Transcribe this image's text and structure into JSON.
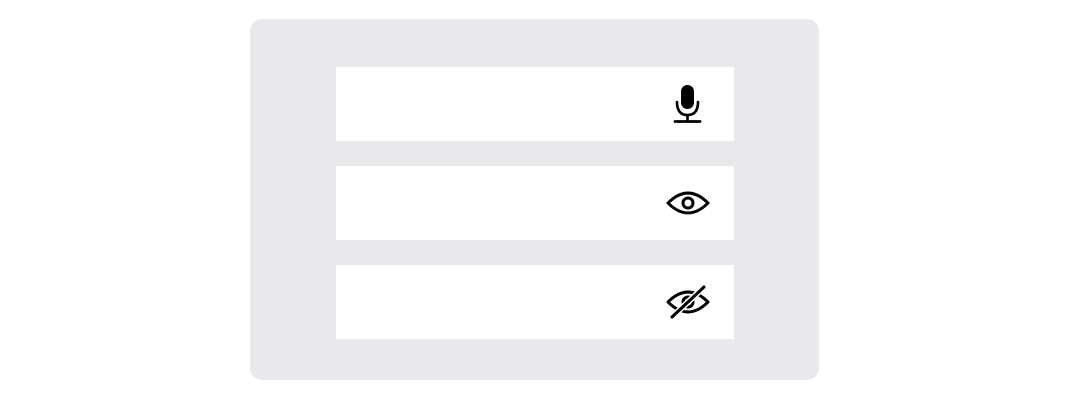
{
  "fields": [
    {
      "value": "",
      "placeholder": "",
      "icon": "microphone-icon"
    },
    {
      "value": "",
      "placeholder": "",
      "icon": "eye-icon"
    },
    {
      "value": "",
      "placeholder": "",
      "icon": "eye-slash-icon"
    }
  ],
  "colors": {
    "panel_background": "#e9e9eb",
    "field_background": "#ffffff",
    "icon_color": "#000000"
  }
}
